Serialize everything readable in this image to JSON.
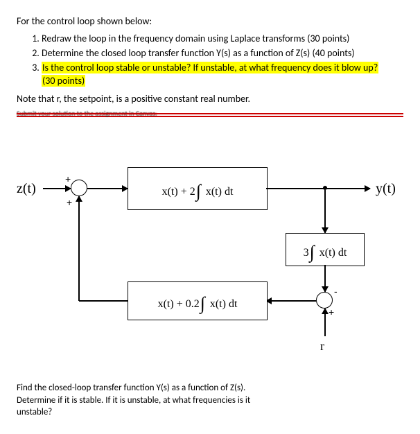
{
  "intro": "For the control loop shown below:",
  "questions": {
    "q1": "Redraw the loop in the frequency domain using Laplace transforms   (30 points)",
    "q2": "Determine the closed loop transfer function Y(s) as a function of Z(s)   (40 points)",
    "q3a": "Is the control loop stable or unstable?  If unstable, at what frequency does it blow up?",
    "q3b": "(30 points)"
  },
  "note": "Note that r, the setpoint, is a positive constant real number.",
  "struck_text": "Submit your solution to the assignment in Canvas.",
  "diagram": {
    "input_label": "z(t)",
    "output_label": "y(t)",
    "setpoint_label": "r",
    "block_forward": "x(t) + 2",
    "block_forward_tail": " x(t) dt",
    "block_inner": "3",
    "block_inner_tail": " x(t) dt",
    "block_outer": "x(t) + 0.2",
    "block_outer_tail": " x(t) dt",
    "signs": {
      "plus": "+",
      "minus": "-"
    }
  },
  "subtext": "Find the closed-loop transfer function Y(s) as a function of Z(s).  Determine if it is stable.  If it is unstable, at what frequencies is it unstable?"
}
